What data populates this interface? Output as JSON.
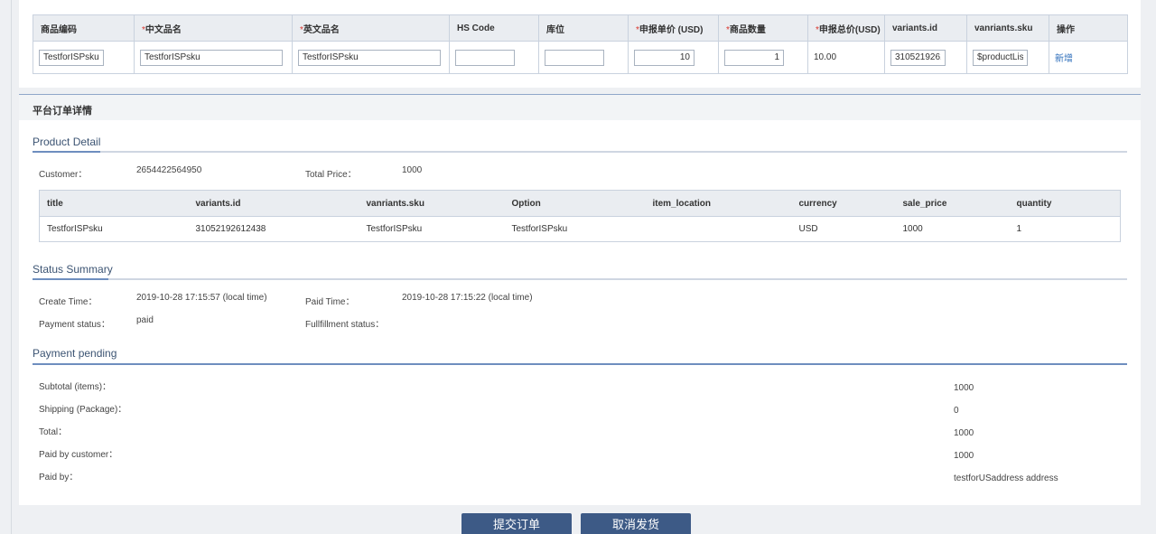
{
  "product_table": {
    "headers": [
      {
        "label": "商品编码",
        "required": false
      },
      {
        "label": "中文品名",
        "required": true
      },
      {
        "label": "英文品名",
        "required": true
      },
      {
        "label": "HS Code",
        "required": false
      },
      {
        "label": "库位",
        "required": false
      },
      {
        "label": "申报单价 (USD)",
        "required": true
      },
      {
        "label": "商品数量",
        "required": true
      },
      {
        "label": "申报总价(USD)",
        "required": true
      },
      {
        "label": "variants.id",
        "required": false
      },
      {
        "label": "vanriants.sku",
        "required": false
      },
      {
        "label": "操作",
        "required": false
      }
    ],
    "required_mark": "*",
    "row": {
      "code": "TestforISPsku",
      "cn_name": "TestforISPsku",
      "en_name": "TestforISPsku",
      "hs_code": "",
      "location": "",
      "unit_price": "10",
      "quantity": "1",
      "total": "10.00",
      "variant_id": "3105219261",
      "variant_sku": "$productLis",
      "action": "新增"
    }
  },
  "detail": {
    "title": "平台订单详情",
    "product_section": {
      "title": "Product Detail",
      "customer_label": "Customer：",
      "customer": "2654422564950",
      "total_price_label": "Total Price：",
      "total_price": "1000",
      "table": {
        "headers": [
          "title",
          "variants.id",
          "vanriants.sku",
          "Option",
          "item_location",
          "currency",
          "sale_price",
          "quantity"
        ],
        "rows": [
          [
            "TestforISPsku",
            "31052192612438",
            "TestforISPsku",
            "TestforISPsku",
            "",
            "USD",
            "1000",
            "1"
          ]
        ]
      }
    },
    "status_section": {
      "title": "Status Summary",
      "create_time_label": "Create Time：",
      "create_time": "2019-10-28 17:15:57 (local time)",
      "paid_time_label": "Paid Time：",
      "paid_time": "2019-10-28 17:15:22 (local time)",
      "payment_status_label": "Payment status：",
      "payment_status": "paid",
      "fulfillment_status_label": "Fullfillment status：",
      "fulfillment_status": ""
    },
    "payment_section": {
      "title": "Payment pending",
      "subtotal_label": "Subtotal (items)：",
      "subtotal": "1000",
      "shipping_label": "Shipping (Package)：",
      "shipping": "0",
      "total_label": "Total：",
      "total": "1000",
      "paid_by_customer_label": "Paid by customer：",
      "paid_by_customer": "1000",
      "paid_by_label": "Paid by：",
      "paid_by": "testforUSaddress address"
    }
  },
  "buttons": {
    "submit": "提交订单",
    "cancel": "取消发货"
  },
  "colors": {
    "primary_button": "#3d5a86",
    "required": "#d9342b",
    "link": "#2f6fbb",
    "section_accent": "#6e8ebf"
  }
}
